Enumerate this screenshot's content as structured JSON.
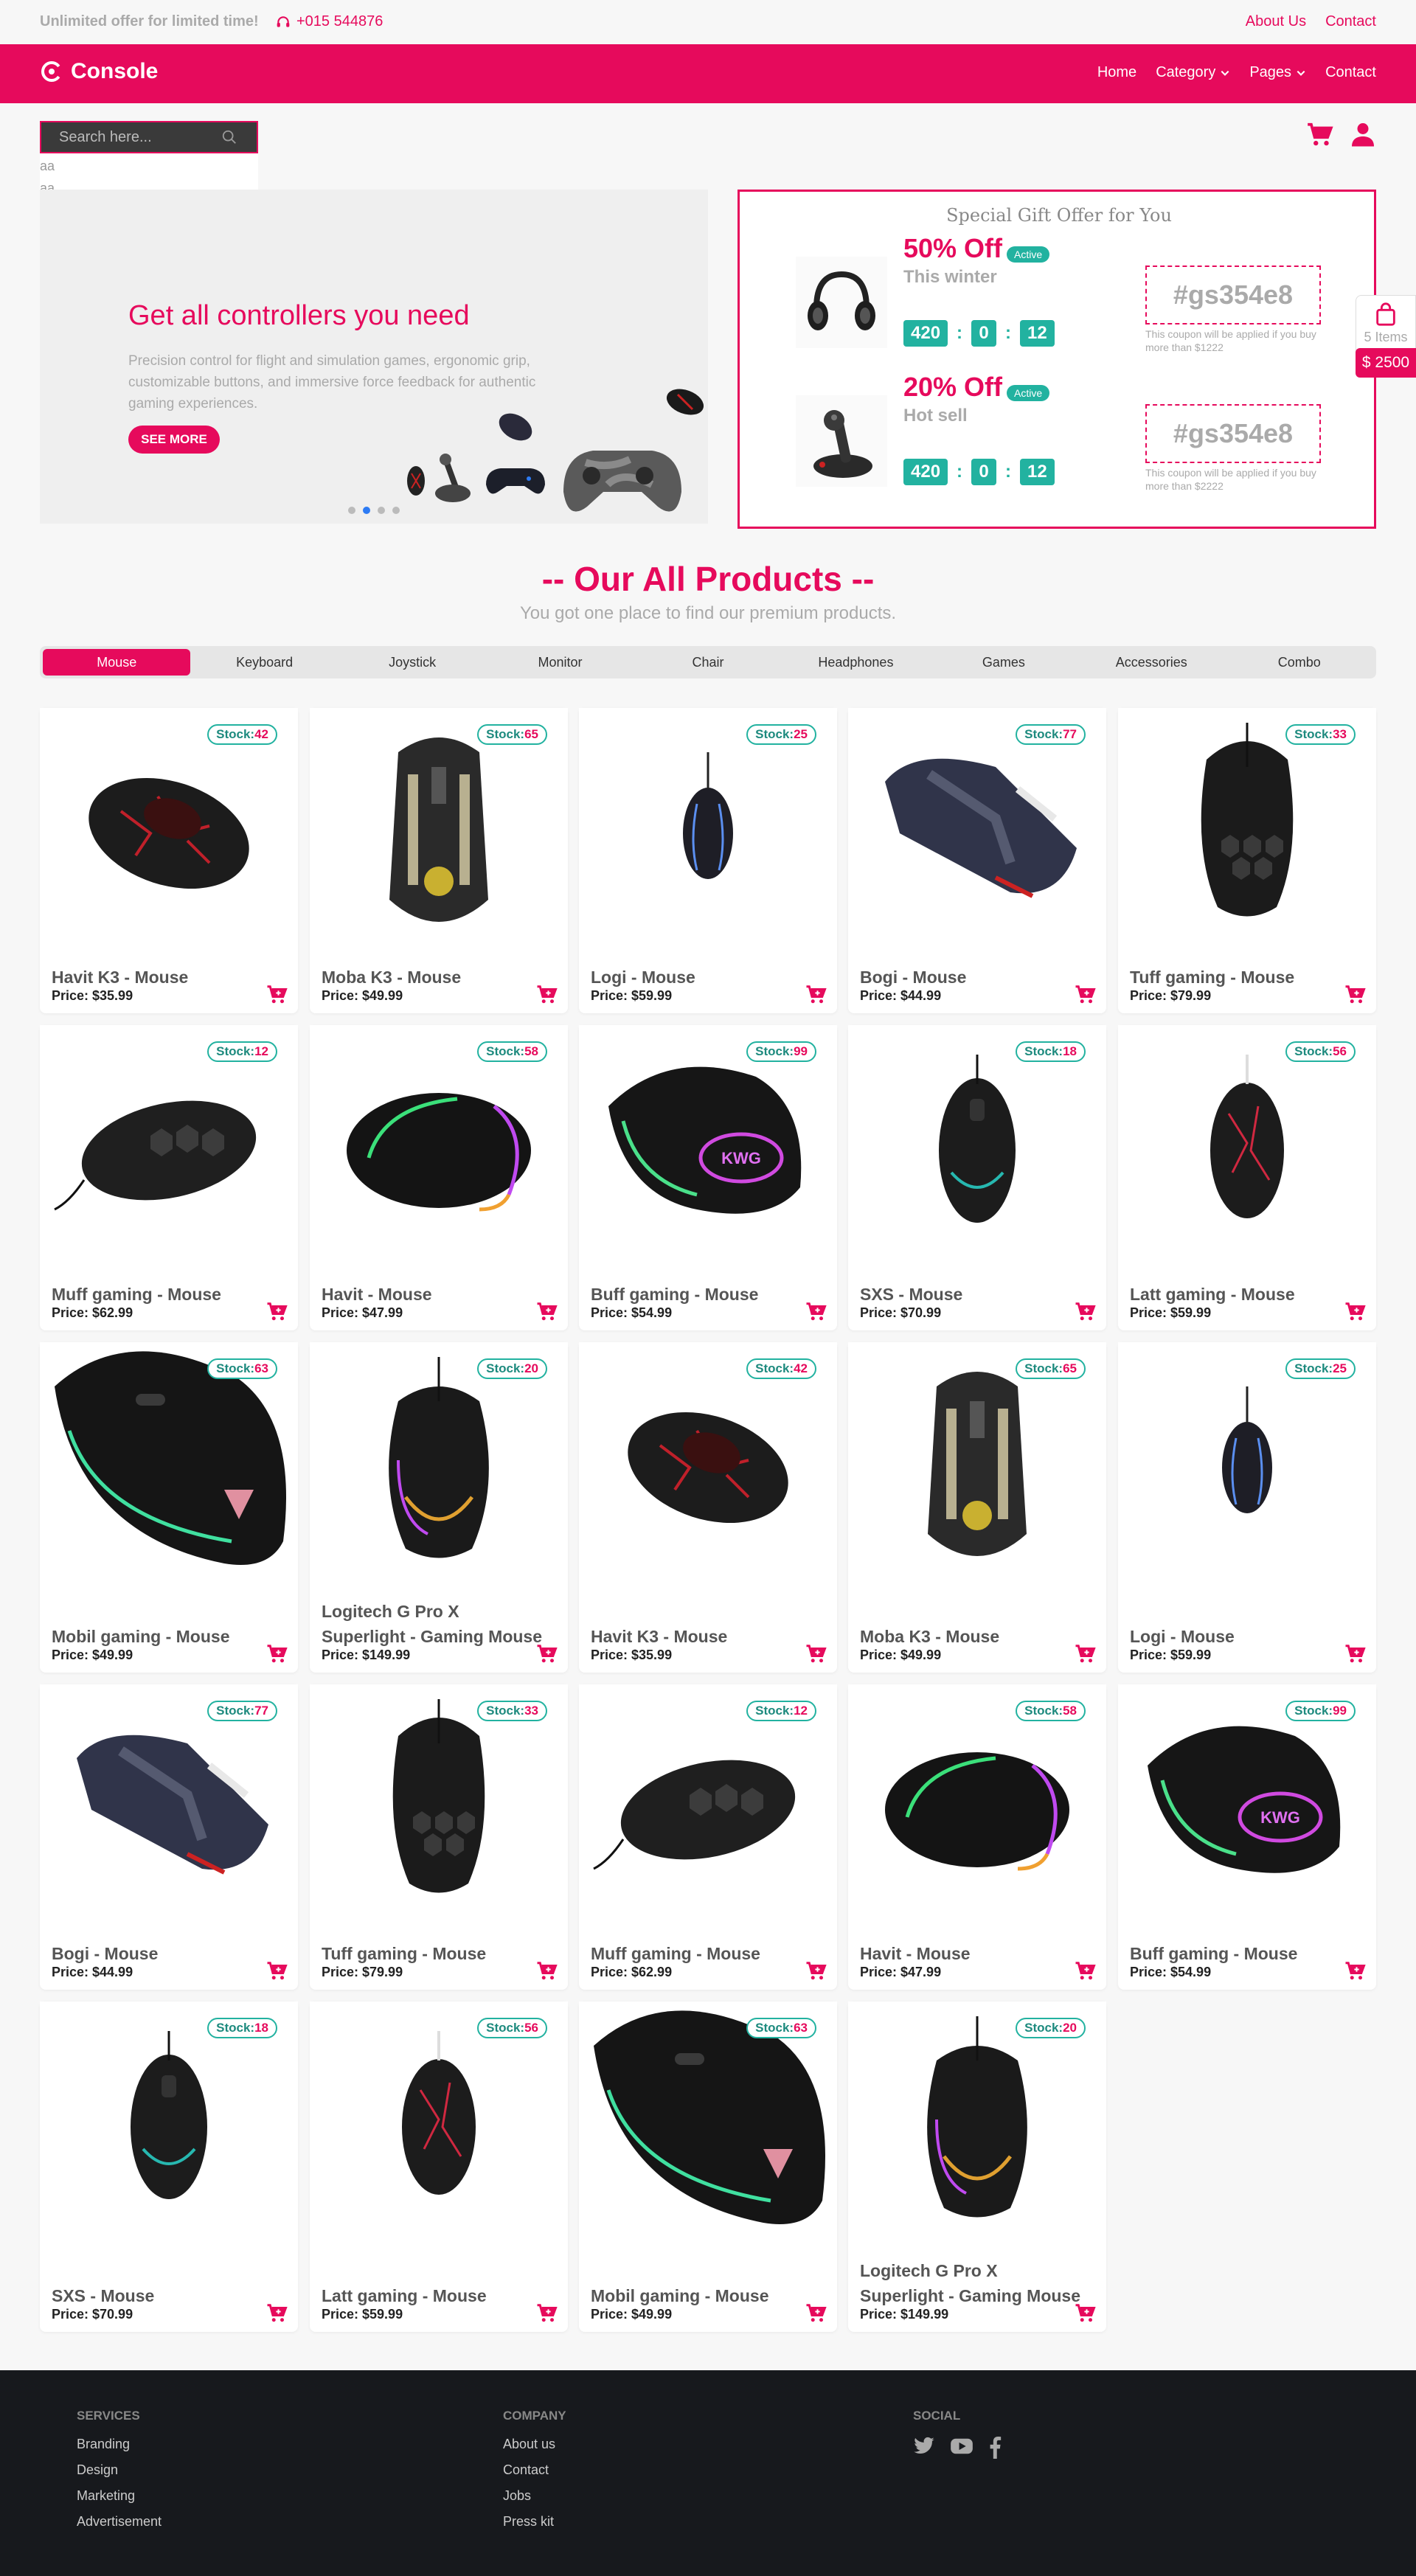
{
  "topbar": {
    "offer": "Unlimited offer for limited time!",
    "phone": "+015 544876",
    "links": [
      "About Us",
      "Contact"
    ]
  },
  "nav": {
    "brand": "Console",
    "menu": [
      "Home",
      "Category",
      "Pages",
      "Contact"
    ]
  },
  "search": {
    "placeholder": "Search here...",
    "suggestions": [
      "aa",
      "aa"
    ]
  },
  "hero": {
    "title": "Get all controllers you need",
    "text": "Precision control for flight and simulation games, ergonomic grip, customizable buttons, and immersive force feedback for authentic gaming experiences.",
    "button": "SEE MORE",
    "slides": 4,
    "active_slide": 1
  },
  "gift": {
    "title": "Special Gift Offer for You",
    "offers": [
      {
        "percent": "50% Off",
        "badge": "Active",
        "subtitle": "This winter",
        "timer": [
          "420",
          "0",
          "12"
        ],
        "code": "#gs354e8",
        "note": "This coupon will be applied if you buy more than $1222",
        "image": "headphones"
      },
      {
        "percent": "20% Off",
        "badge": "Active",
        "subtitle": "Hot sell",
        "timer": [
          "420",
          "0",
          "12"
        ],
        "code": "#gs354e8",
        "note": "This coupon will be applied if you buy more than $2222",
        "image": "joystick"
      }
    ]
  },
  "cart_widget": {
    "items": "5 Items",
    "total": "$ 2500"
  },
  "products_section": {
    "title": "-- Our All Products --",
    "subtitle": "You got one place to find our premium products."
  },
  "categories": [
    "Mouse",
    "Keyboard",
    "Joystick",
    "Monitor",
    "Chair",
    "Headphones",
    "Games",
    "Accessories",
    "Combo"
  ],
  "active_category": "Mouse",
  "stock_label": "Stock:",
  "products": [
    {
      "name": "Havit K3 - Mouse",
      "price": "Price: $35.99",
      "stock": "42",
      "style": "red-crack"
    },
    {
      "name": "Moba K3 - Mouse",
      "price": "Price: $49.99",
      "stock": "65",
      "style": "gold"
    },
    {
      "name": "Logi - Mouse",
      "price": "Price: $59.99",
      "stock": "25",
      "style": "small-blue"
    },
    {
      "name": "Bogi - Mouse",
      "price": "Price: $44.99",
      "stock": "77",
      "style": "navy"
    },
    {
      "name": "Tuff gaming - Mouse",
      "price": "Price: $79.99",
      "stock": "33",
      "style": "honeycomb"
    },
    {
      "name": "Muff gaming - Mouse",
      "price": "Price: $62.99",
      "stock": "12",
      "style": "honeycomb-side"
    },
    {
      "name": "Havit - Mouse",
      "price": "Price: $47.99",
      "stock": "58",
      "style": "rgb-side"
    },
    {
      "name": "Buff gaming - Mouse",
      "price": "Price: $54.99",
      "stock": "99",
      "style": "rgb-logo"
    },
    {
      "name": "SXS - Mouse",
      "price": "Price: $70.99",
      "stock": "18",
      "style": "teal"
    },
    {
      "name": "Latt gaming - Mouse",
      "price": "Price: $59.99",
      "stock": "56",
      "style": "red-crack-top"
    },
    {
      "name": "Mobil gaming - Mouse",
      "price": "Price: $49.99",
      "stock": "63",
      "style": "large-green"
    },
    {
      "name": "Logitech G Pro X Superlight - Gaming Mouse",
      "price": "Price: $149.99",
      "stock": "20",
      "style": "rgb-top"
    },
    {
      "name": "Havit K3 - Mouse",
      "price": "Price: $35.99",
      "stock": "42",
      "style": "red-crack"
    },
    {
      "name": "Moba K3 - Mouse",
      "price": "Price: $49.99",
      "stock": "65",
      "style": "gold"
    },
    {
      "name": "Logi - Mouse",
      "price": "Price: $59.99",
      "stock": "25",
      "style": "small-blue"
    },
    {
      "name": "Bogi - Mouse",
      "price": "Price: $44.99",
      "stock": "77",
      "style": "navy"
    },
    {
      "name": "Tuff gaming - Mouse",
      "price": "Price: $79.99",
      "stock": "33",
      "style": "honeycomb"
    },
    {
      "name": "Muff gaming - Mouse",
      "price": "Price: $62.99",
      "stock": "12",
      "style": "honeycomb-side"
    },
    {
      "name": "Havit - Mouse",
      "price": "Price: $47.99",
      "stock": "58",
      "style": "rgb-side"
    },
    {
      "name": "Buff gaming - Mouse",
      "price": "Price: $54.99",
      "stock": "99",
      "style": "rgb-logo"
    },
    {
      "name": "SXS - Mouse",
      "price": "Price: $70.99",
      "stock": "18",
      "style": "teal"
    },
    {
      "name": "Latt gaming - Mouse",
      "price": "Price: $59.99",
      "stock": "56",
      "style": "red-crack-top"
    },
    {
      "name": "Mobil gaming - Mouse",
      "price": "Price: $49.99",
      "stock": "63",
      "style": "large-green"
    },
    {
      "name": "Logitech G Pro X Superlight - Gaming Mouse",
      "price": "Price: $149.99",
      "stock": "20",
      "style": "rgb-top"
    }
  ],
  "footer": {
    "columns": [
      {
        "title": "SERVICES",
        "links": [
          "Branding",
          "Design",
          "Marketing",
          "Advertisement"
        ]
      },
      {
        "title": "COMPANY",
        "links": [
          "About us",
          "Contact",
          "Jobs",
          "Press kit"
        ]
      },
      {
        "title": "SOCIAL",
        "icons": [
          "twitter-icon",
          "youtube-icon",
          "facebook-icon"
        ]
      }
    ]
  },
  "colors": {
    "brand": "#e60a5c",
    "teal": "#22b2a0",
    "footer": "#17191d"
  }
}
